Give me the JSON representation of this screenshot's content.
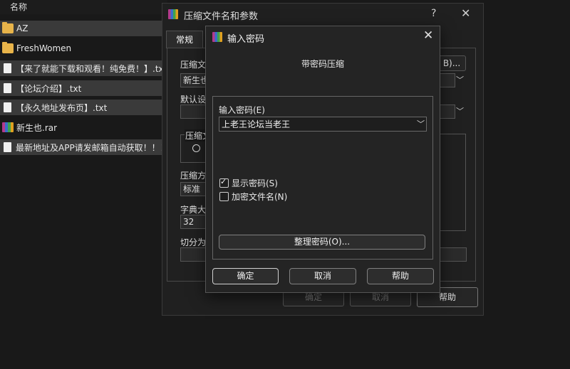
{
  "explorer": {
    "column_name": "名称",
    "files": [
      {
        "name": "AZ",
        "icon": "folder-icon"
      },
      {
        "name": "FreshWomen",
        "icon": "folder-icon"
      },
      {
        "name": "【来了就能下载和观看！纯免费！】.txt",
        "icon": "text-file-icon"
      },
      {
        "name": "【论坛介绍】.txt",
        "icon": "text-file-icon"
      },
      {
        "name": "【永久地址发布页】.txt",
        "icon": "text-file-icon"
      },
      {
        "name": "新生也.rar",
        "icon": "rar-archive-icon"
      },
      {
        "name": "最新地址及APP请发邮箱自动获取！！！",
        "icon": "text-file-icon"
      }
    ]
  },
  "back_dialog": {
    "title": "压缩文件名和参数",
    "help_glyph": "?",
    "close_glyph": "✕",
    "tab_general": "常规",
    "label_archive": "压缩文",
    "archive_value": "新生也",
    "browse_suffix": "B)...",
    "label_default": "默认设",
    "label_format": "压缩文",
    "label_method": "压缩方",
    "method_value": "标准",
    "label_dict": "字典大",
    "dict_value": "32",
    "label_split": "切分为",
    "ok": "确定",
    "cancel": "取消",
    "help": "帮助"
  },
  "password_dialog": {
    "title": "输入密码",
    "close_glyph": "✕",
    "heading": "带密码压缩",
    "password_label": "输入密码(E)",
    "password_value": "上老王论坛当老王",
    "dropdown_glyph": "﹀",
    "show_password": {
      "label": "显示密码(S)",
      "checked": true
    },
    "encrypt_filenames": {
      "label": "加密文件名(N)",
      "checked": false
    },
    "organize_button": "整理密码(O)...",
    "ok": "确定",
    "cancel": "取消",
    "help": "帮助"
  }
}
